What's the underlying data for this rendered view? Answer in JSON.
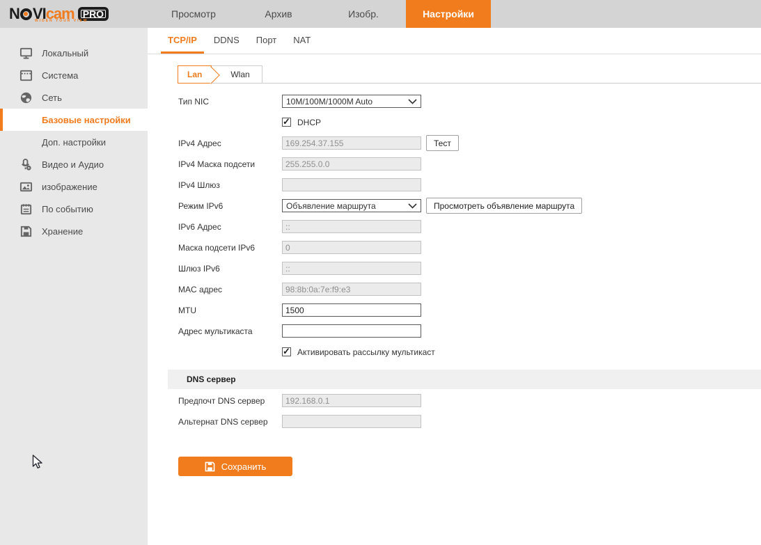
{
  "colors": {
    "accent": "#F07C1E",
    "topbar_bg": "#D4D4D4",
    "sidebar_bg": "#E8E8E8",
    "disabled_input_bg": "#EBEBEB",
    "section_band_bg": "#F0F0F0"
  },
  "topbar": {
    "logo": {
      "part1": "N",
      "part2": "VI",
      "cam": "cam",
      "badge": "PRO",
      "tagline": "WIDEN YOUR VIEW"
    },
    "nav": [
      {
        "label": "Просмотр",
        "active": false
      },
      {
        "label": "Архив",
        "active": false
      },
      {
        "label": "Изобр.",
        "active": false
      },
      {
        "label": "Настройки",
        "active": true
      }
    ]
  },
  "sidebar": {
    "items": [
      {
        "label": "Локальный",
        "icon": "monitor-icon"
      },
      {
        "label": "Система",
        "icon": "system-icon"
      },
      {
        "label": "Сеть",
        "icon": "network-icon"
      },
      {
        "label": "Базовые настройки",
        "sub": true,
        "active": true
      },
      {
        "label": "Доп. настройки",
        "sub": true,
        "active": false
      },
      {
        "label": "Видео и Аудио",
        "icon": "audio-video-icon"
      },
      {
        "label": "изображение",
        "icon": "image-icon"
      },
      {
        "label": "По событию",
        "icon": "event-icon"
      },
      {
        "label": "Хранение",
        "icon": "storage-icon"
      }
    ]
  },
  "tabs": [
    {
      "label": "TCP/IP",
      "active": true
    },
    {
      "label": "DDNS",
      "active": false
    },
    {
      "label": "Порт",
      "active": false
    },
    {
      "label": "NAT",
      "active": false
    }
  ],
  "subtabs": [
    {
      "label": "Lan",
      "active": true
    },
    {
      "label": "Wlan",
      "active": false
    }
  ],
  "form": {
    "nic_type": {
      "label": "Тип NIC",
      "value": "10M/100M/1000M Auto"
    },
    "dhcp": {
      "label": "DHCP",
      "checked": true
    },
    "ipv4_address": {
      "label": "IPv4 Адрес",
      "value": "169.254.37.155",
      "disabled": true
    },
    "test_button": "Тест",
    "ipv4_mask": {
      "label": "IPv4 Маска подсети",
      "value": "255.255.0.0",
      "disabled": true
    },
    "ipv4_gateway": {
      "label": "IPv4 Шлюз",
      "value": "",
      "disabled": true
    },
    "ipv6_mode": {
      "label": "Режим IPv6",
      "value": "Объявление маршрута"
    },
    "view_ra_button": "Просмотреть объявление маршрута",
    "ipv6_address": {
      "label": "IPv6 Адрес",
      "value": "::",
      "disabled": true
    },
    "ipv6_mask": {
      "label": "Маска подсети IPv6",
      "value": "0",
      "disabled": true
    },
    "ipv6_gateway": {
      "label": "Шлюз IPv6",
      "value": "::",
      "disabled": true
    },
    "mac_address": {
      "label": "MAC адрес",
      "value": "98:8b:0a:7e:f9:e3",
      "disabled": true
    },
    "mtu": {
      "label": "MTU",
      "value": "1500"
    },
    "multicast_address": {
      "label": "Адрес мультикаста",
      "value": ""
    },
    "multicast_enable": {
      "label": "Активировать рассылку мультикаст",
      "checked": true
    },
    "dns_section_title": "DNS сервер",
    "preferred_dns": {
      "label": "Предпочт DNS сервер",
      "value": "192.168.0.1",
      "disabled": true
    },
    "alternate_dns": {
      "label": "Альтернат DNS сервер",
      "value": "",
      "disabled": true
    },
    "save_button": "Сохранить"
  }
}
